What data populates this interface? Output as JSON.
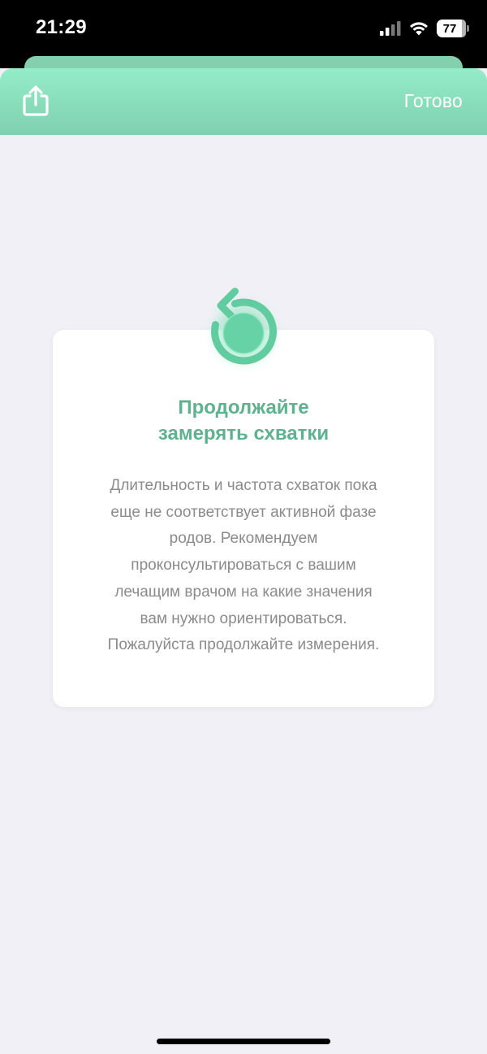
{
  "status_bar": {
    "time": "21:29",
    "battery": "77",
    "icons": [
      "signal-icon",
      "wifi-icon",
      "battery-icon"
    ]
  },
  "header": {
    "share_icon": "share-icon",
    "done_label": "Готово"
  },
  "card": {
    "icon": "restart-arrow-icon",
    "title_line1": "Продолжайте",
    "title_line2": "замерять схватки",
    "body_lines": [
      "Длительность и частота схваток пока",
      "еще не соответствует активной фазе",
      "родов. Рекомендуем",
      "проконсультироваться с вашим",
      "лечащим врачом на какие значения",
      "вам нужно ориентироваться.",
      "Пожалуйста продолжайте измерения."
    ]
  },
  "colors": {
    "accent": "#5fb28f",
    "header_top": "#94ecc8",
    "header_bottom": "#7fd0b0",
    "background": "#f0f0f6",
    "body_text": "#8b8b8b"
  }
}
